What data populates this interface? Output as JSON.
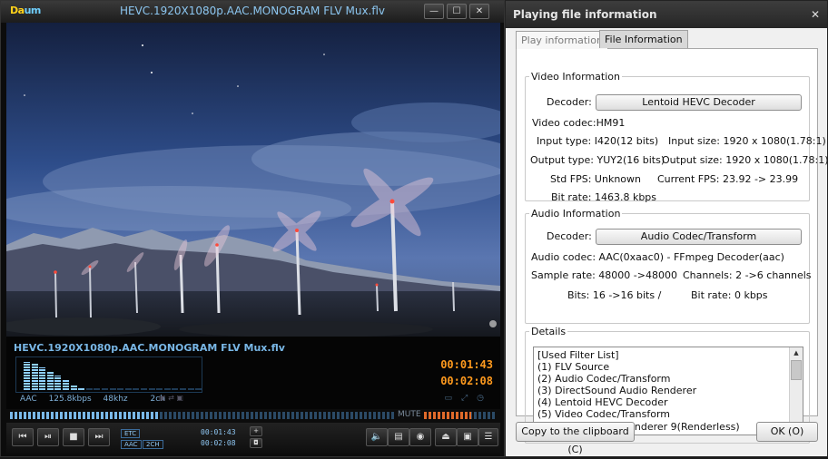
{
  "player": {
    "logo_a": "Da",
    "logo_b": "um",
    "title": "HEVC.1920X1080p.AAC.MONOGRAM FLV Mux.flv",
    "min_glyph": "—",
    "max_glyph": "☐",
    "close_glyph": "✕",
    "band_title": "HEVC.1920X1080p.AAC.MONOGRAM FLV Mux.flv",
    "audio_format": "AAC",
    "audio_bitrate": "125.8kbps",
    "audio_rate": "48khz",
    "audio_channels": "2ch",
    "time_current": "00:01:43",
    "time_total": "00:02:08",
    "seek_progress": 0.39,
    "volume_level": 0.65,
    "mute_label": "MUTE",
    "pill_etc": "ETC",
    "pill_aac": "AAC",
    "pill_2ch": "2CH",
    "lcd_current": "00:01:43",
    "lcd_total": "00:02:08",
    "eq_levels": [
      0.85,
      0.8,
      0.7,
      0.55,
      0.45,
      0.3,
      0.15,
      0.08,
      0.05,
      0.04,
      0.03,
      0.03,
      0.03,
      0.03,
      0.03,
      0.03,
      0.03,
      0.03,
      0.03,
      0.03,
      0.03,
      0.03,
      0.03
    ],
    "accent_color": "#79b7e6",
    "time_color": "#ff9a1e",
    "control_icons": {
      "prev": "prev-icon",
      "pause": "pause-icon",
      "stop": "stop-icon",
      "next": "next-icon",
      "volume": "speaker-icon",
      "subtitle": "subtitle-icon",
      "settings": "settings-icon",
      "eject": "eject-icon",
      "capture": "capture-icon",
      "playlist": "playlist-icon"
    }
  },
  "dialog": {
    "title": "Playing file information",
    "close_glyph": "✕",
    "tabs": [
      {
        "label": "Play information"
      },
      {
        "label": "File Information"
      }
    ],
    "video": {
      "legend": "Video Information",
      "decoder_label": "Decoder:",
      "decoder_value": "Lentoid HEVC Decoder",
      "codec": "Video codec:HM91",
      "input_type": "Input type: I420(12 bits)",
      "input_size": "Input size: 1920 x 1080(1.78:1)",
      "output_type": "Output type: YUY2(16 bits)",
      "output_size": "Output size: 1920 x 1080(1.78:1)",
      "std_fps": "Std FPS: Unknown",
      "current_fps": "Current FPS: 23.92 -> 23.99",
      "bit_rate": "Bit rate: 1463.8 kbps"
    },
    "audio": {
      "legend": "Audio Information",
      "decoder_label": "Decoder:",
      "decoder_value": "Audio Codec/Transform",
      "codec": "Audio codec: AAC(0xaac0) - FFmpeg Decoder(aac)",
      "sample_rate": "Sample rate: 48000 ->48000",
      "channels": "Channels: 2 ->6 channels",
      "bits": "Bits: 16 ->16 bits /",
      "bit_rate": "Bit rate: 0 kbps"
    },
    "details": {
      "legend": "Details",
      "lines": [
        "[Used Filter List]",
        "(1) FLV Source",
        "(2) Audio Codec/Transform",
        "(3) DirectSound Audio Renderer",
        "(4) Lentoid HEVC Decoder",
        "(5) Video Codec/Transform",
        "(6) Video Mixing Renderer 9(Renderless)"
      ]
    },
    "copy_label": "Copy to the clipboard (C)",
    "ok_label": "OK (O)"
  }
}
